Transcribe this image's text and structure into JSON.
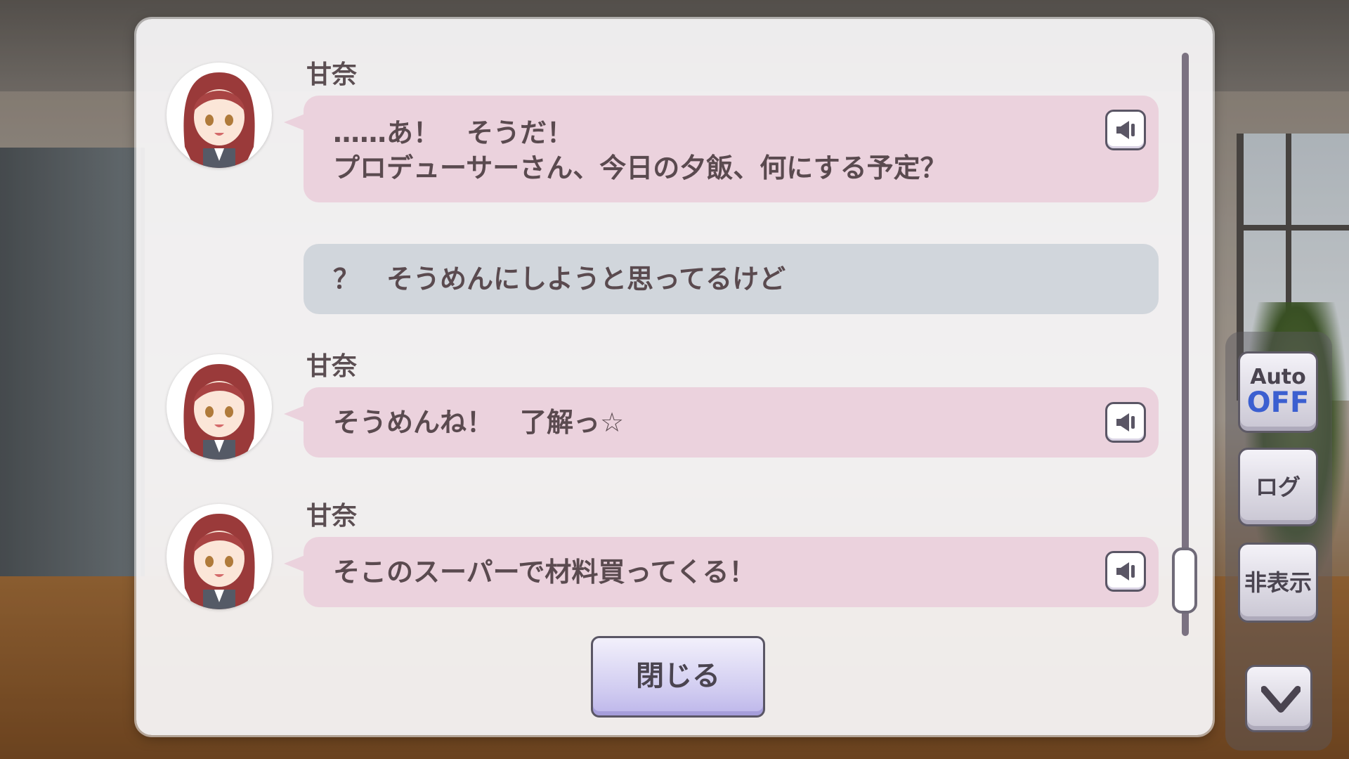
{
  "dialog_log": {
    "entries": [
      {
        "speaker": "甘奈",
        "lines": [
          "……あ！　そうだ！",
          "プロデューサーさん、今日の夕飯、何にする予定？"
        ],
        "type": "character",
        "has_voice": true
      },
      {
        "speaker": "",
        "lines": [
          "？　そうめんにしようと思ってるけど"
        ],
        "type": "choice",
        "has_voice": false
      },
      {
        "speaker": "甘奈",
        "lines": [
          "そうめんね！　了解っ☆"
        ],
        "type": "character",
        "has_voice": true
      },
      {
        "speaker": "甘奈",
        "lines": [
          "そこのスーパーで材料買ってくる！"
        ],
        "type": "character",
        "has_voice": true
      }
    ],
    "close_label": "閉じる"
  },
  "side_controls": {
    "auto_label": "Auto",
    "auto_state": "OFF",
    "log_label": "ログ",
    "hide_label": "非表示"
  },
  "colors": {
    "character_bubble": "#ebd2dd",
    "choice_bubble": "#d1d6dc",
    "auto_state": "#3b5fd0"
  }
}
